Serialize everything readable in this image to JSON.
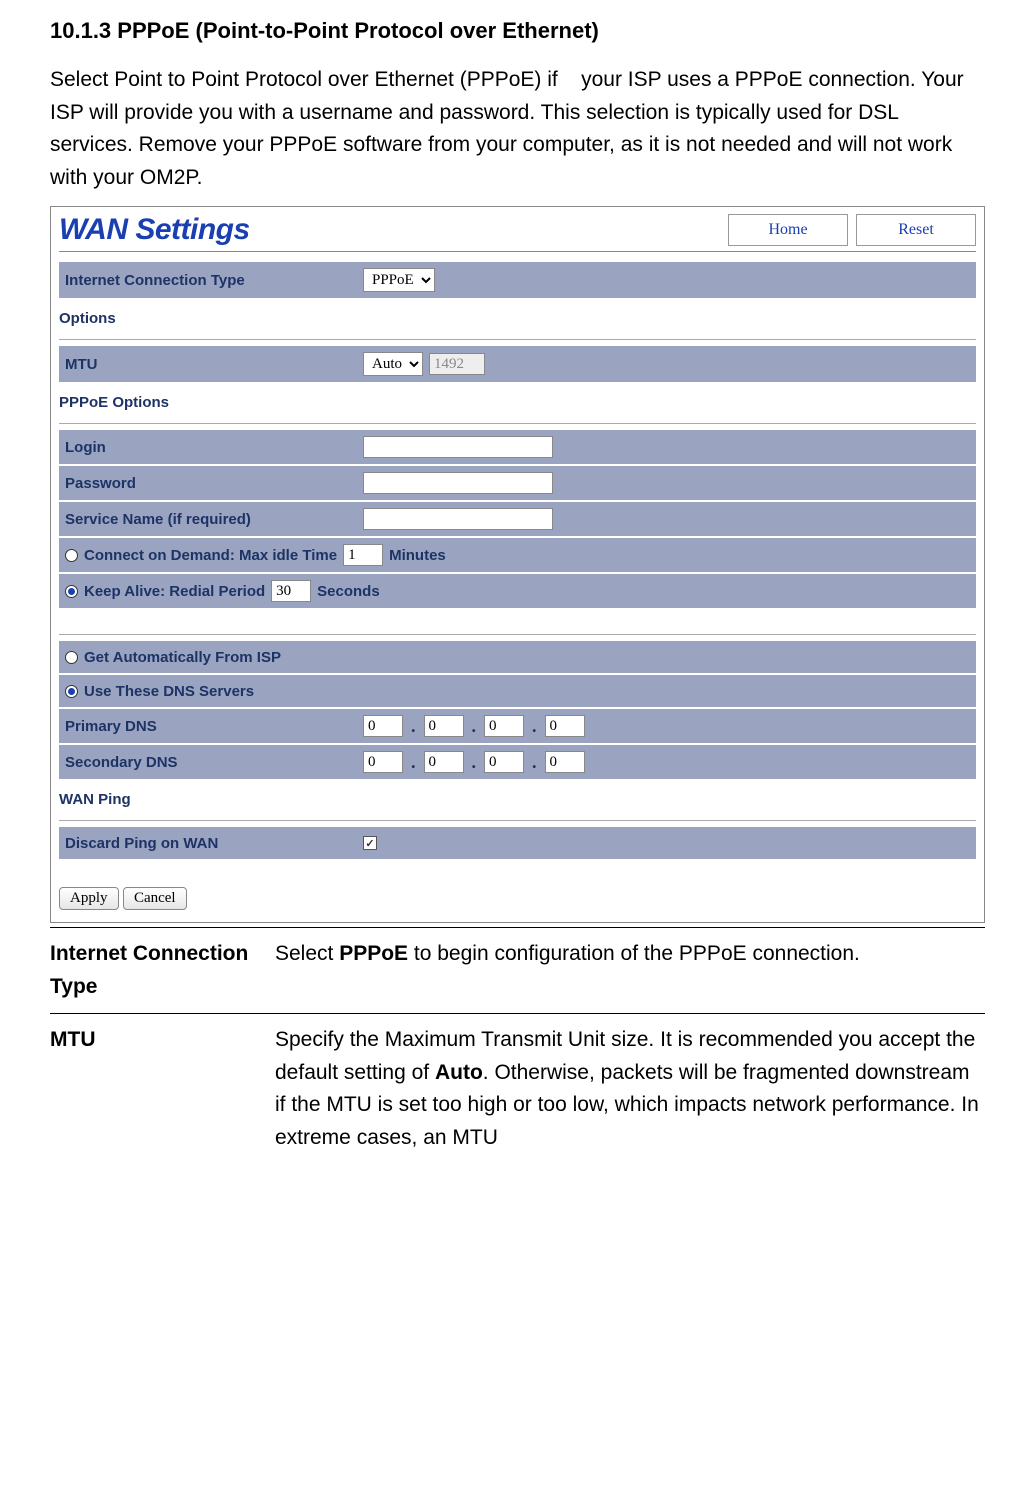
{
  "doc": {
    "heading": "10.1.3 PPPoE (Point-to-Point Protocol over Ethernet)",
    "para": "Select Point to Point Protocol over Ethernet (PPPoE) if    your ISP uses a PPPoE connection. Your ISP will provide you with a username and password. This selection is typically used for DSL services. Remove your PPPoE software from your computer, as it is not needed and will not work with your OM2P."
  },
  "panel": {
    "title": "WAN Settings",
    "home_btn": "Home",
    "reset_btn": "Reset",
    "conn_type_label": "Internet Connection Type",
    "conn_type_value": "PPPoE",
    "options_head": "Options",
    "mtu_label": "MTU",
    "mtu_mode": "Auto",
    "mtu_value": "1492",
    "pppoe_head": "PPPoE Options",
    "login_label": "Login",
    "login_value": "",
    "password_label": "Password",
    "password_value": "",
    "service_label": "Service Name (if required)",
    "service_value": "",
    "cod_label_a": "Connect on Demand: Max idle Time",
    "cod_value": "1",
    "cod_label_b": "Minutes",
    "ka_label_a": "Keep Alive: Redial Period",
    "ka_value": "30",
    "ka_label_b": "Seconds",
    "dns_auto_label": "Get Automatically From ISP",
    "dns_use_label": "Use These DNS Servers",
    "primary_dns_label": "Primary DNS",
    "secondary_dns_label": "Secondary DNS",
    "dns_a1": "0",
    "dns_a2": "0",
    "dns_a3": "0",
    "dns_a4": "0",
    "dns_b1": "0",
    "dns_b2": "0",
    "dns_b3": "0",
    "dns_b4": "0",
    "wanping_head": "WAN Ping",
    "discard_label": "Discard Ping on WAN",
    "discard_checked_glyph": "✓",
    "apply_btn": "Apply",
    "cancel_btn": "Cancel"
  },
  "defs": {
    "r1_term": "Internet Connection Type",
    "r1_desc_a": "Select ",
    "r1_desc_b": "PPPoE",
    "r1_desc_c": " to begin configuration of the PPPoE connection.",
    "r2_term": "MTU",
    "r2_desc_a": "Specify the Maximum Transmit Unit size. It is recommended you accept the default setting of ",
    "r2_desc_b": "Auto",
    "r2_desc_c": ". Otherwise, packets will be fragmented downstream if the MTU is set too high or too low, which impacts network performance. In extreme cases, an MTU"
  }
}
